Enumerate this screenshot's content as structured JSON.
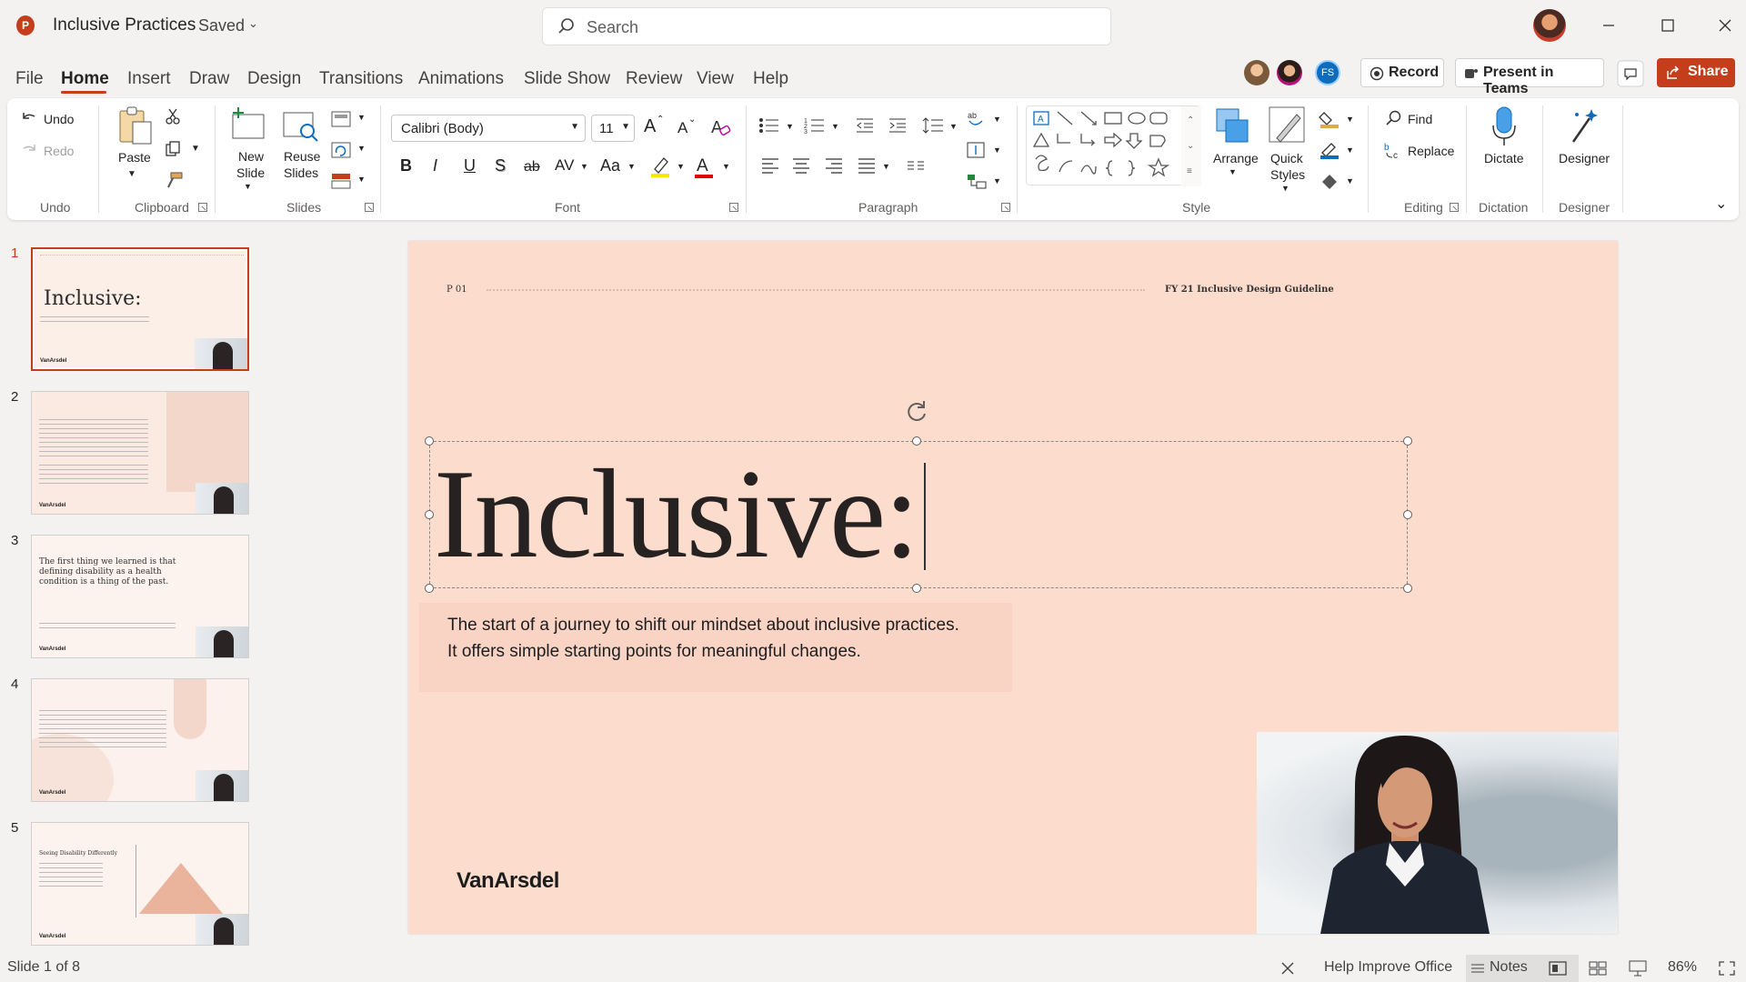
{
  "titlebar": {
    "app_icon": "powerpoint-icon",
    "doc_title": "Inclusive Practices",
    "doc_status": "Saved",
    "search_placeholder": "Search"
  },
  "menu": {
    "tabs": [
      "File",
      "Home",
      "Insert",
      "Draw",
      "Design",
      "Transitions",
      "Animations",
      "Slide Show",
      "Review",
      "View",
      "Help"
    ],
    "active": "Home",
    "record": "Record",
    "present": "Present in Teams",
    "share": "Share",
    "collab_initials": "FS"
  },
  "ribbon": {
    "undo": {
      "undo": "Undo",
      "redo": "Redo",
      "label": "Undo"
    },
    "clipboard": {
      "paste": "Paste",
      "label": "Clipboard"
    },
    "slides": {
      "new_slide_1": "New",
      "new_slide_2": "Slide",
      "reuse_1": "Reuse",
      "reuse_2": "Slides",
      "label": "Slides"
    },
    "font": {
      "family": "Calibri (Body)",
      "size": "11",
      "label": "Font",
      "bold": "B",
      "italic": "I",
      "underline": "U",
      "shadow": "S",
      "strike": "ab",
      "spacing": "AV",
      "case": "Aa",
      "grow": "A",
      "shrink": "A",
      "color_a": "A"
    },
    "paragraph": {
      "label": "Paragraph"
    },
    "style": {
      "arrange": "Arrange",
      "quick_1": "Quick",
      "quick_2": "Styles",
      "label": "Style"
    },
    "editing": {
      "find": "Find",
      "replace": "Replace",
      "label": "Editing"
    },
    "dictation": {
      "dictate": "Dictate",
      "label": "Dictation"
    },
    "designer": {
      "designer": "Designer",
      "label": "Designer"
    }
  },
  "thumbnails": {
    "numbers": [
      "1",
      "2",
      "3",
      "4",
      "5"
    ],
    "t1_title": "Inclusive:",
    "t3_quote": "The first thing we learned is that defining disability as a health condition is a thing of the past.",
    "t5_title": "Seeing Disability Differently",
    "logo": "VanArsdel"
  },
  "slide": {
    "page": "P 01",
    "guideline": "FY 21 Inclusive Design Guideline",
    "title": "Inclusive:",
    "subtitle_1": "The start of a journey to shift our mindset about inclusive practices.",
    "subtitle_2": "It offers simple starting points for meaningful changes.",
    "logo": "VanArsdel"
  },
  "statusbar": {
    "slide_count": "Slide 1 of 8",
    "help": "Help Improve Office",
    "notes": "Notes",
    "zoom": "86%"
  },
  "colors": {
    "accent": "#c43e1c",
    "slide_bg": "#fcdccd"
  }
}
